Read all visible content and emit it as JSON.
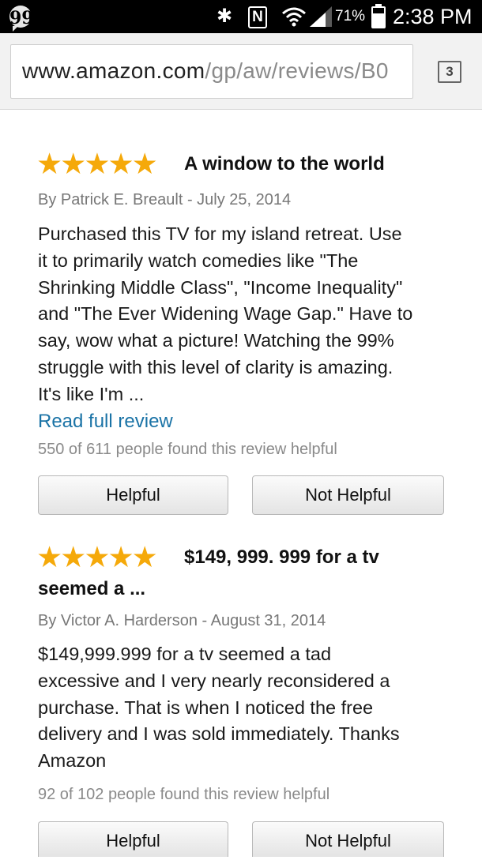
{
  "status_bar": {
    "battery_percent": "71%",
    "time": "2:38 PM",
    "nfc_label": "N",
    "icons": [
      "hangouts-icon",
      "bluetooth-icon",
      "nfc-icon",
      "wifi-icon",
      "signal-icon",
      "battery-icon"
    ]
  },
  "browser": {
    "url_host": "www.amazon.com",
    "url_path": "/gp/aw/reviews/B0",
    "tab_count": "3"
  },
  "colors": {
    "star": "#f5a90a",
    "link": "#1a73a6",
    "meta_text": "#777777"
  },
  "reviews": [
    {
      "stars": "★★★★★",
      "rating": 5,
      "title": "A window to the world",
      "byline": "By Patrick E. Breault - July 25, 2014",
      "body": [
        "Purchased this TV for my island retreat. Use",
        "it to primarily watch comedies like \"The",
        "Shrinking Middle Class\", \"Income Inequality\"",
        "and \"The Ever Widening Wage Gap.\" Have to",
        "say, wow what a picture! Watching the 99%",
        "struggle with this level of clarity is amazing.",
        "It's like I'm ..."
      ],
      "read_more": "Read full review",
      "helpful_count": "550 of 611 people found this review helpful",
      "helpful_label": "Helpful",
      "not_helpful_label": "Not Helpful"
    },
    {
      "stars": "★★★★★",
      "rating": 5,
      "title_line1": "$149, 999. 999 for a tv",
      "title_line2": "seemed a ...",
      "byline": "By Victor A. Harderson - August 31, 2014",
      "body": [
        "$149,999.999 for a tv seemed a tad",
        "excessive and I very nearly reconsidered a",
        "purchase. That is when I noticed the free",
        "delivery and I was sold immediately. Thanks",
        "Amazon"
      ],
      "helpful_count": "92 of 102 people found this review helpful",
      "helpful_label": "Helpful",
      "not_helpful_label": "Not Helpful"
    }
  ]
}
